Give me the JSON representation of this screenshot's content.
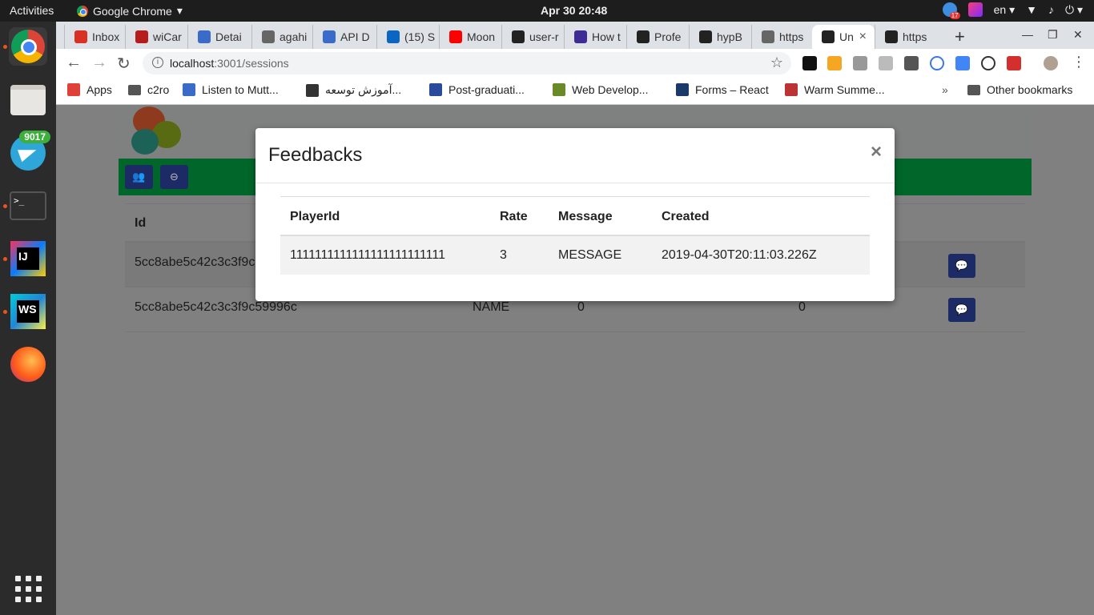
{
  "os": {
    "activities": "Activities",
    "app_name": "Google Chrome",
    "datetime": "Apr 30  20:48",
    "lang": "en",
    "notif_count": "17",
    "telegram_badge": "9017"
  },
  "browser": {
    "tabs": [
      {
        "label": "Inbox",
        "icon": "gmail-icon",
        "color": "#d93025"
      },
      {
        "label": "wiCar",
        "icon": "wicar-icon",
        "color": "#b71c1c"
      },
      {
        "label": "Detai",
        "icon": "detail-icon",
        "color": "#3b6bc9"
      },
      {
        "label": "agahi",
        "icon": "globe-icon",
        "color": "#666666"
      },
      {
        "label": "API D",
        "icon": "api-icon",
        "color": "#3b6bc9"
      },
      {
        "label": "(15) S",
        "icon": "linkedin-icon",
        "color": "#0a66c2"
      },
      {
        "label": "Moon",
        "icon": "youtube-icon",
        "color": "#ff0000"
      },
      {
        "label": "user-r",
        "icon": "github-icon",
        "color": "#222222"
      },
      {
        "label": "How t",
        "icon": "howto-icon",
        "color": "#3f2b96"
      },
      {
        "label": "Profe",
        "icon": "star-icon",
        "color": "#222222"
      },
      {
        "label": "hypB",
        "icon": "github-icon",
        "color": "#222222"
      },
      {
        "label": "https",
        "icon": "globe-icon",
        "color": "#666666"
      },
      {
        "label": "Un",
        "icon": "react-icon",
        "color": "#222222"
      },
      {
        "label": "https",
        "icon": "react-icon",
        "color": "#222222"
      }
    ],
    "url_host": "localhost",
    "url_rest": ":3001/sessions",
    "bookmarks": [
      {
        "label": "Apps"
      },
      {
        "label": "c2ro"
      },
      {
        "label": "Listen to Mutt..."
      },
      {
        "label": "آموزش توسعه..."
      },
      {
        "label": "Post-graduati..."
      },
      {
        "label": "Web Develop..."
      },
      {
        "label": "Forms – React"
      },
      {
        "label": "Warm Summe..."
      }
    ],
    "other_bookmarks": "Other bookmarks"
  },
  "app": {
    "table": {
      "headers": {
        "id": "Id"
      },
      "rows": [
        {
          "id": "5cc8abe5c42c3c3f9c",
          "name": "",
          "c1": "",
          "c2": ""
        },
        {
          "id": "5cc8abe5c42c3c3f9c59996c",
          "name": "NAME",
          "c1": "0",
          "c2": "0"
        }
      ]
    }
  },
  "modal": {
    "title": "Feedbacks",
    "close": "×",
    "headers": {
      "player": "PlayerId",
      "rate": "Rate",
      "message": "Message",
      "created": "Created"
    },
    "rows": [
      {
        "player": "1111111111111111111111111",
        "rate": "3",
        "message": "MESSAGE",
        "created": "2019-04-30T20:11:03.226Z"
      }
    ]
  }
}
